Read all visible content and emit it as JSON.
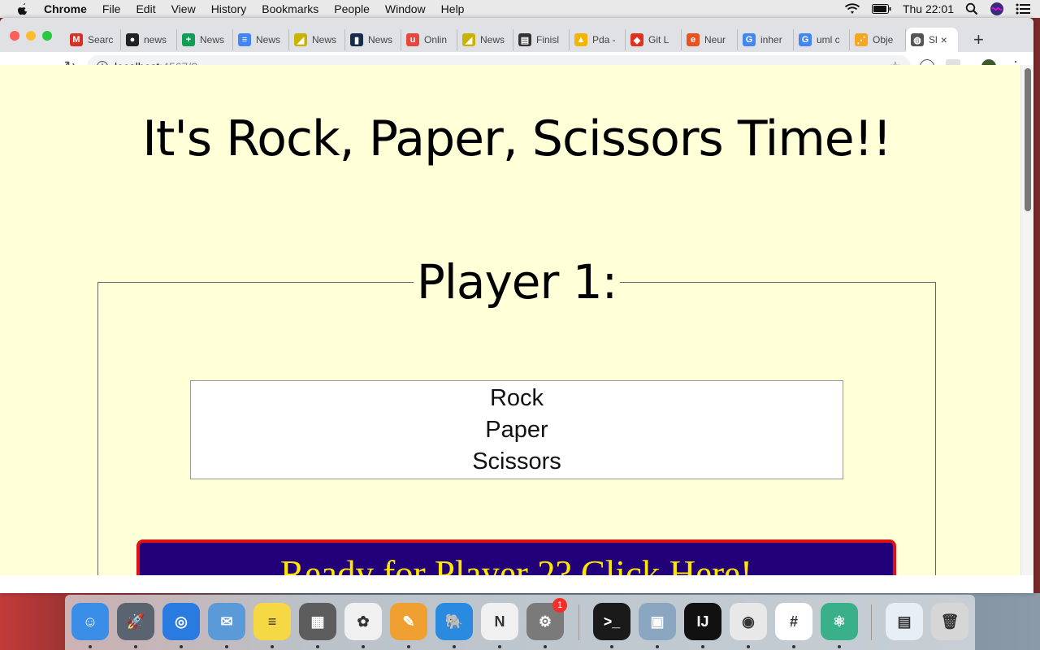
{
  "menubar": {
    "app_name": "Chrome",
    "items": [
      "File",
      "Edit",
      "View",
      "History",
      "Bookmarks",
      "People",
      "Window",
      "Help"
    ],
    "clock": "Thu 22:01"
  },
  "tabs": [
    {
      "label": "Searc",
      "icon": "gmail-icon",
      "color": "#d93025",
      "glyph": "M"
    },
    {
      "label": "news",
      "icon": "github-icon",
      "color": "#222222",
      "glyph": "●"
    },
    {
      "label": "News",
      "icon": "sheets-icon",
      "color": "#0f9d58",
      "glyph": "+"
    },
    {
      "label": "News",
      "icon": "docs-icon",
      "color": "#4285f4",
      "glyph": "≡"
    },
    {
      "label": "News",
      "icon": "pda-icon",
      "color": "#c8b400",
      "glyph": "◢"
    },
    {
      "label": "News",
      "icon": "trello-icon",
      "color": "#172b4d",
      "glyph": "▮"
    },
    {
      "label": "Onlin",
      "icon": "online-icon",
      "color": "#e8453c",
      "glyph": "u"
    },
    {
      "label": "News",
      "icon": "pda-icon",
      "color": "#c8b400",
      "glyph": "◢"
    },
    {
      "label": "Finisl",
      "icon": "finish-icon",
      "color": "#333333",
      "glyph": "▤"
    },
    {
      "label": "Pda -",
      "icon": "drive-icon",
      "color": "#f4b400",
      "glyph": "▲"
    },
    {
      "label": "Git L",
      "icon": "git-icon",
      "color": "#e0301e",
      "glyph": "◆"
    },
    {
      "label": "Neur",
      "icon": "neur-icon",
      "color": "#e8531f",
      "glyph": "e"
    },
    {
      "label": "inher",
      "icon": "google-icon",
      "color": "#4285f4",
      "glyph": "G"
    },
    {
      "label": "uml c",
      "icon": "google-icon",
      "color": "#4285f4",
      "glyph": "G"
    },
    {
      "label": "Obje",
      "icon": "object-icon",
      "color": "#f5a623",
      "glyph": "⋰"
    },
    {
      "label": "Sl",
      "icon": "globe-icon",
      "color": "#555555",
      "glyph": "◍",
      "active": true
    }
  ],
  "address": {
    "host": "localhost",
    "path": ":4567/?"
  },
  "page": {
    "title": "It's Rock, Paper, Scissors Time!!",
    "legend": "Player 1:",
    "choices": [
      "Rock",
      "Paper",
      "Scissors"
    ],
    "button": "Ready for Player 2? Click Here!"
  },
  "dock": {
    "apps": [
      {
        "name": "finder-icon",
        "color": "#3b8ee8",
        "glyph": "☺"
      },
      {
        "name": "launchpad-icon",
        "color": "#5a6470",
        "glyph": "🚀"
      },
      {
        "name": "safari-icon",
        "color": "#2a7be0",
        "glyph": "◎"
      },
      {
        "name": "mail-icon",
        "color": "#5b9ad8",
        "glyph": "✉"
      },
      {
        "name": "notes-icon",
        "color": "#f6d845",
        "glyph": "≡"
      },
      {
        "name": "calculator-icon",
        "color": "#5d5d5d",
        "glyph": "▦"
      },
      {
        "name": "photos-icon",
        "color": "#f0f0f0",
        "glyph": "✿"
      },
      {
        "name": "pages-icon",
        "color": "#f0a030",
        "glyph": "✎"
      },
      {
        "name": "tableplus-icon",
        "color": "#2a8adf",
        "glyph": "🐘"
      },
      {
        "name": "news-icon",
        "color": "#f0f0f0",
        "glyph": "N"
      },
      {
        "name": "system-preferences-icon",
        "color": "#7a7a7a",
        "glyph": "⚙",
        "badge": "1"
      },
      {
        "name": "terminal-icon",
        "color": "#1a1a1a",
        "glyph": ">_"
      },
      {
        "name": "preview-icon",
        "color": "#8aa6c0",
        "glyph": "▣"
      },
      {
        "name": "intellij-icon",
        "color": "#111111",
        "glyph": "IJ"
      },
      {
        "name": "chrome-icon",
        "color": "#e8e8e8",
        "glyph": "◉"
      },
      {
        "name": "slack-icon",
        "color": "#ffffff",
        "glyph": "#"
      },
      {
        "name": "atom-icon",
        "color": "#3ab08a",
        "glyph": "⚛"
      },
      {
        "name": "downloads-icon",
        "color": "#e8eef5",
        "glyph": "▤"
      },
      {
        "name": "trash-icon",
        "color": "#d6d6d6",
        "glyph": "🗑"
      }
    ]
  },
  "colors": {
    "page_bg": "#ffffd8",
    "button_bg": "#21007a",
    "button_border": "#e21010",
    "button_text": "#ffe800"
  }
}
